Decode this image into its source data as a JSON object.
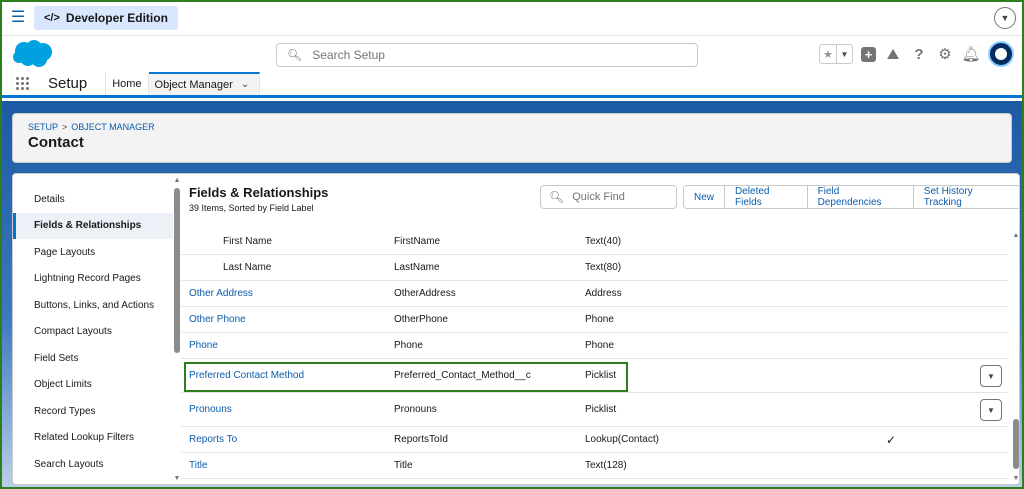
{
  "context_bar": {
    "edition_icon": "</>",
    "edition_label": "Developer Edition"
  },
  "header": {
    "search_placeholder": "Search Setup"
  },
  "app_nav": {
    "app_name": "Setup",
    "items": [
      {
        "label": "Home"
      },
      {
        "label": "Object Manager"
      }
    ]
  },
  "page_header": {
    "breadcrumb": [
      "SETUP",
      "OBJECT MANAGER"
    ],
    "breadcrumb_sep": ">",
    "title": "Contact"
  },
  "left_nav": {
    "items": [
      {
        "label": "Details"
      },
      {
        "label": "Fields & Relationships"
      },
      {
        "label": "Page Layouts"
      },
      {
        "label": "Lightning Record Pages"
      },
      {
        "label": "Buttons, Links, and Actions"
      },
      {
        "label": "Compact Layouts"
      },
      {
        "label": "Field Sets"
      },
      {
        "label": "Object Limits"
      },
      {
        "label": "Record Types"
      },
      {
        "label": "Related Lookup Filters"
      },
      {
        "label": "Search Layouts"
      }
    ],
    "active_index": 1
  },
  "content": {
    "title": "Fields & Relationships",
    "subtitle": "39 Items, Sorted by Field Label",
    "quick_find_placeholder": "Quick Find",
    "buttons": [
      "New",
      "Deleted Fields",
      "Field Dependencies",
      "Set History Tracking"
    ]
  },
  "fields": [
    {
      "label": "First Name",
      "api": "FirstName",
      "type": "Text(40)",
      "indexed": "",
      "link": false,
      "indent": true,
      "menu": false
    },
    {
      "label": "Last Name",
      "api": "LastName",
      "type": "Text(80)",
      "indexed": "",
      "link": false,
      "indent": true,
      "menu": false
    },
    {
      "label": "Other Address",
      "api": "OtherAddress",
      "type": "Address",
      "indexed": "",
      "link": true,
      "indent": false,
      "menu": false
    },
    {
      "label": "Other Phone",
      "api": "OtherPhone",
      "type": "Phone",
      "indexed": "",
      "link": true,
      "indent": false,
      "menu": false
    },
    {
      "label": "Phone",
      "api": "Phone",
      "type": "Phone",
      "indexed": "",
      "link": true,
      "indent": false,
      "menu": false
    },
    {
      "label": "Preferred Contact Method",
      "api": "Preferred_Contact_Method__c",
      "type": "Picklist",
      "indexed": "",
      "link": true,
      "indent": false,
      "menu": true,
      "highlighted": true
    },
    {
      "label": "Pronouns",
      "api": "Pronouns",
      "type": "Picklist",
      "indexed": "",
      "link": true,
      "indent": false,
      "menu": true
    },
    {
      "label": "Reports To",
      "api": "ReportsToId",
      "type": "Lookup(Contact)",
      "indexed": "✓",
      "link": true,
      "indent": false,
      "menu": false
    },
    {
      "label": "Title",
      "api": "Title",
      "type": "Text(128)",
      "indexed": "",
      "link": true,
      "indent": false,
      "menu": false
    }
  ],
  "colors": {
    "brand_blue": "#0176d3",
    "link_blue": "#0b5cab",
    "highlight_green": "#2e7d1f"
  }
}
